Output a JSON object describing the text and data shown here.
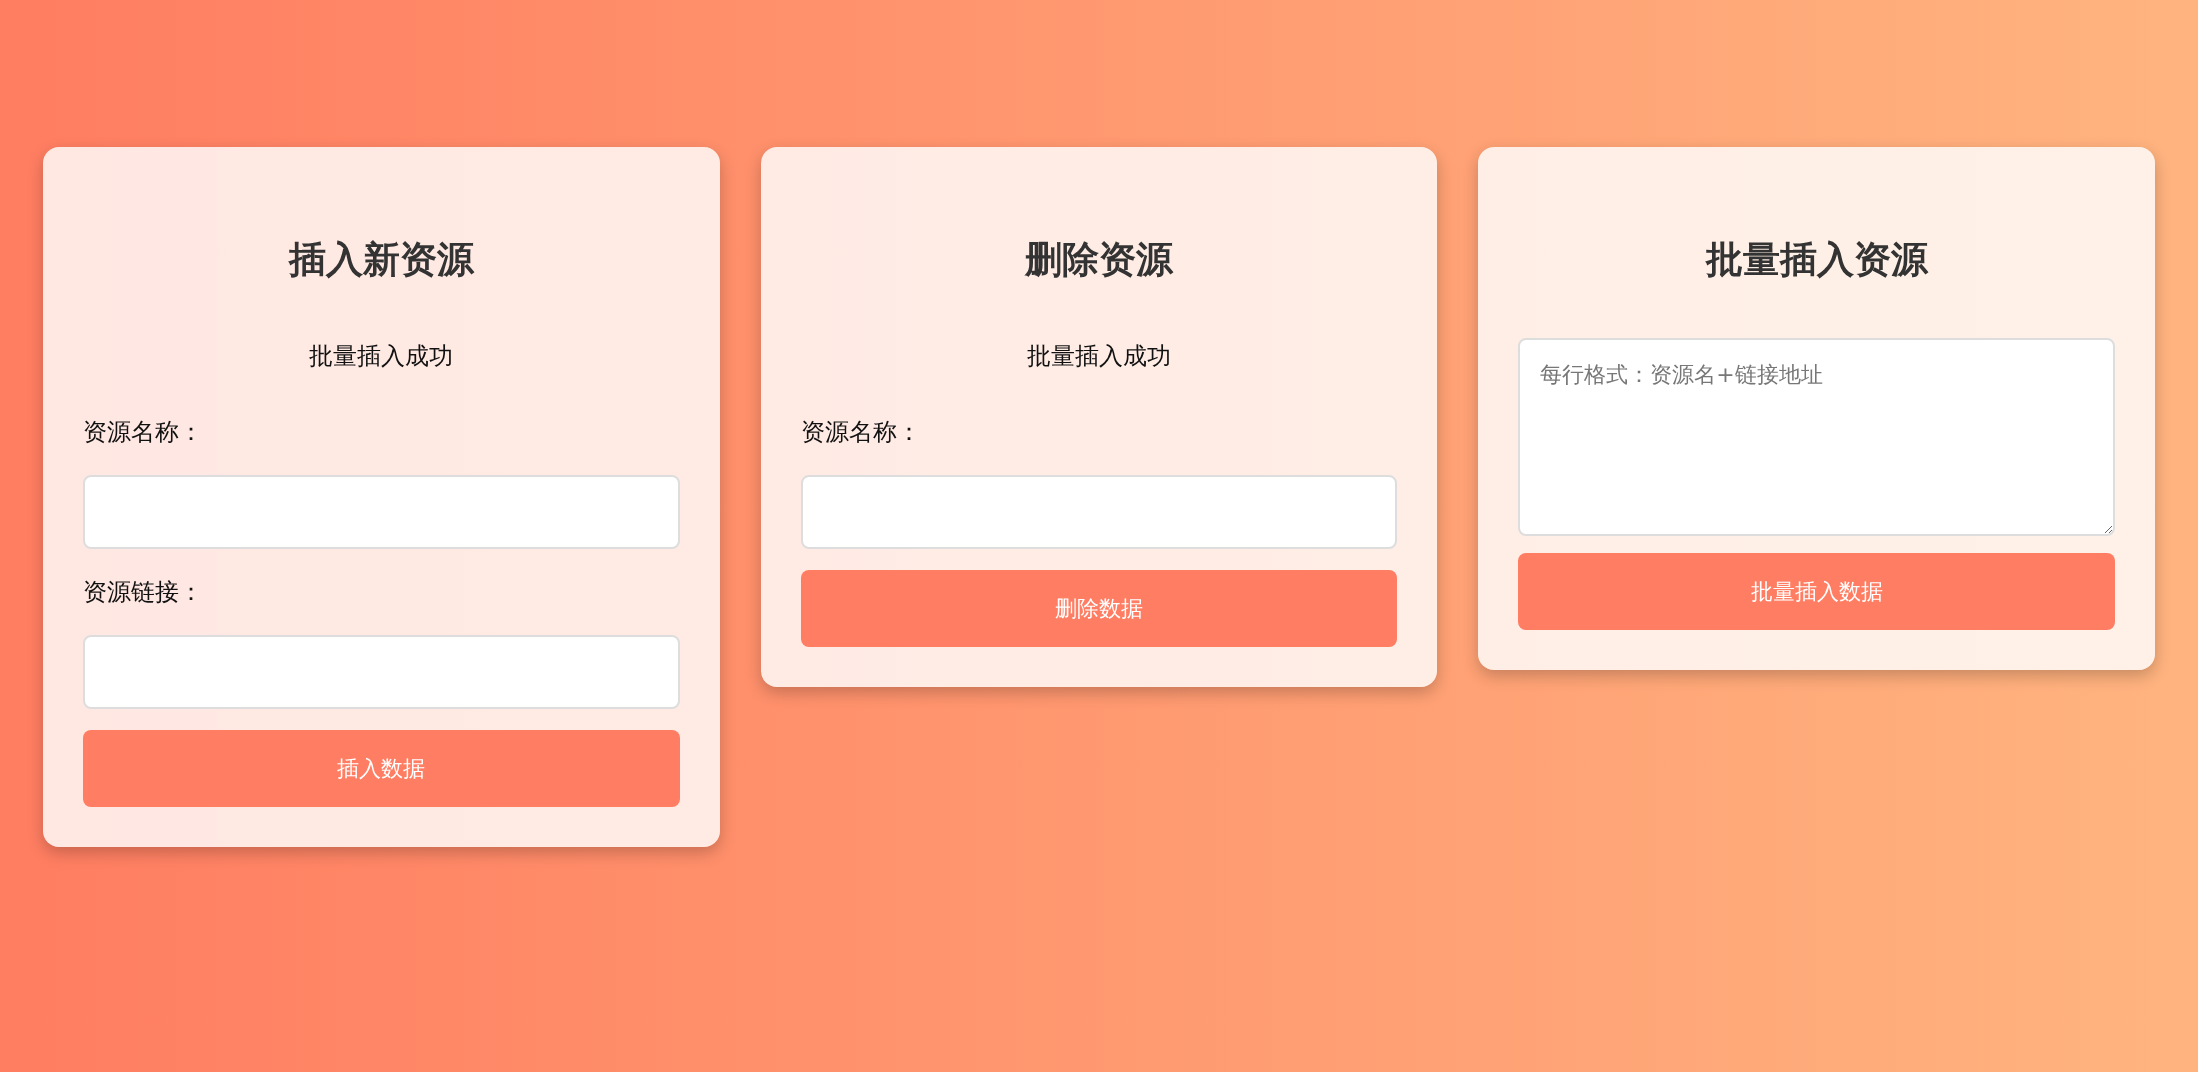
{
  "cards": [
    {
      "title": "插入新资源",
      "items": [
        {
          "kind": "message",
          "text": "批量插入成功"
        },
        {
          "kind": "label",
          "text": "资源名称："
        },
        {
          "kind": "input"
        },
        {
          "kind": "label",
          "text": "资源链接："
        },
        {
          "kind": "input"
        },
        {
          "kind": "button",
          "text": "插入数据"
        }
      ]
    },
    {
      "title": "删除资源",
      "items": [
        {
          "kind": "message",
          "text": "批量插入成功"
        },
        {
          "kind": "label",
          "text": "资源名称："
        },
        {
          "kind": "input"
        },
        {
          "kind": "button",
          "text": "删除数据"
        }
      ]
    },
    {
      "title": "批量插入资源",
      "items": [
        {
          "kind": "textarea",
          "placeholder": "每行格式：资源名+链接地址"
        },
        {
          "kind": "button",
          "text": "批量插入数据"
        }
      ]
    }
  ]
}
